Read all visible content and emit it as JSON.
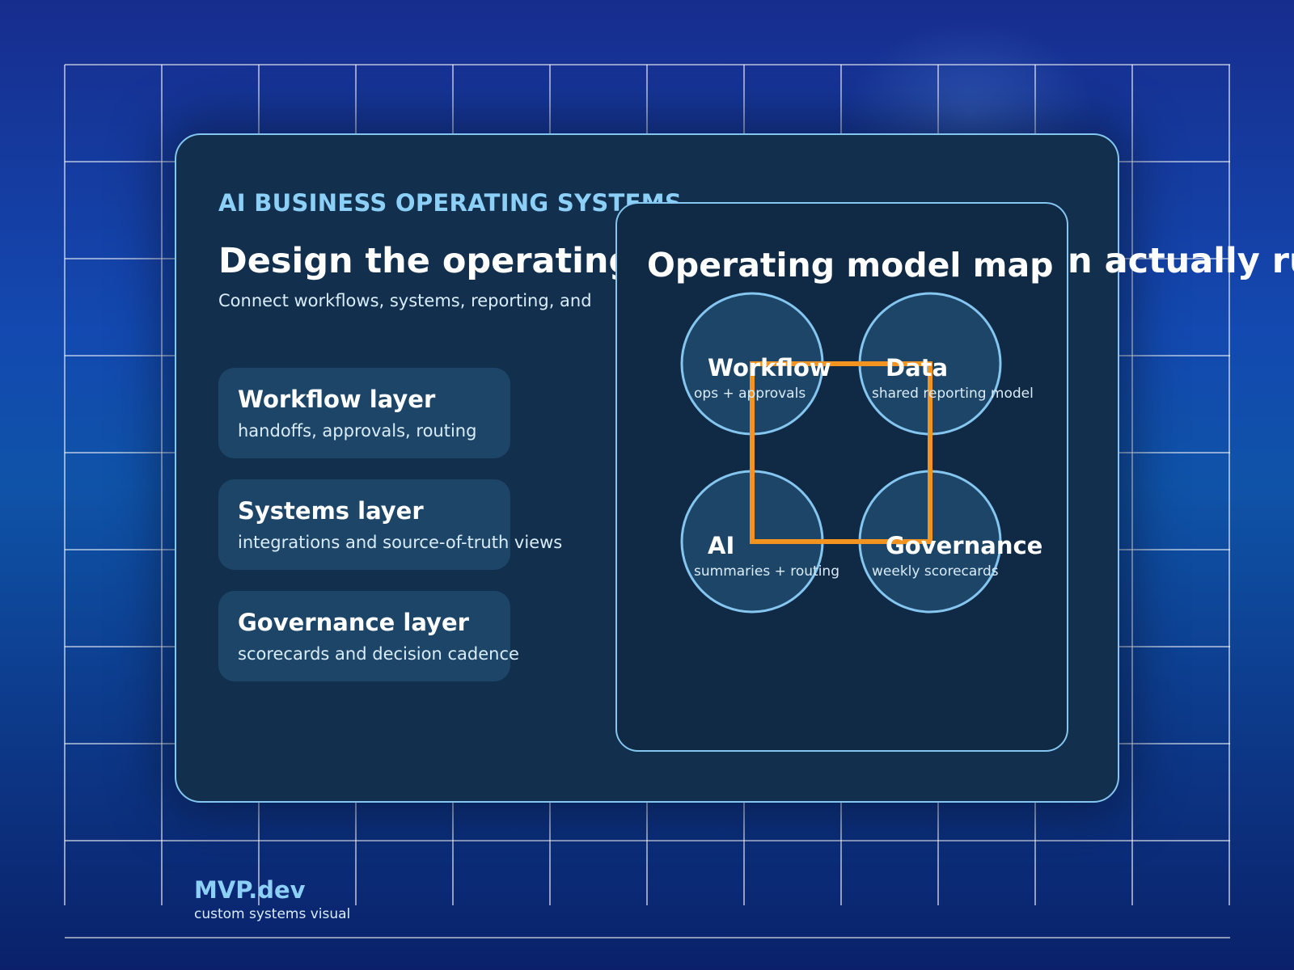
{
  "eyebrow": "AI BUSINESS OPERATING SYSTEMS",
  "headline_visible": "Design the operating",
  "headline_overflow": "n actually ru",
  "subheadline": "Connect workflows, systems, reporting, and",
  "layers": [
    {
      "title": "Workflow layer",
      "description": "handoffs, approvals, routing"
    },
    {
      "title": "Systems layer",
      "description": "integrations and source-of-truth views"
    },
    {
      "title": "Governance layer",
      "description": "scorecards and decision cadence"
    }
  ],
  "map": {
    "title": "Operating model map",
    "nodes": [
      {
        "title": "Workflow",
        "subtitle": "ops + approvals"
      },
      {
        "title": "Data",
        "subtitle": "shared reporting model"
      },
      {
        "title": "AI",
        "subtitle": "summaries + routing"
      },
      {
        "title": "Governance",
        "subtitle": "weekly scorecards"
      }
    ]
  },
  "brand": {
    "name": "MVP.dev",
    "tagline": "custom systems visual"
  },
  "colors": {
    "accent_light_blue": "#8dd0f7",
    "connector_orange": "#f39320",
    "card_bg": "#12304e",
    "node_fill": "#1d4568"
  }
}
